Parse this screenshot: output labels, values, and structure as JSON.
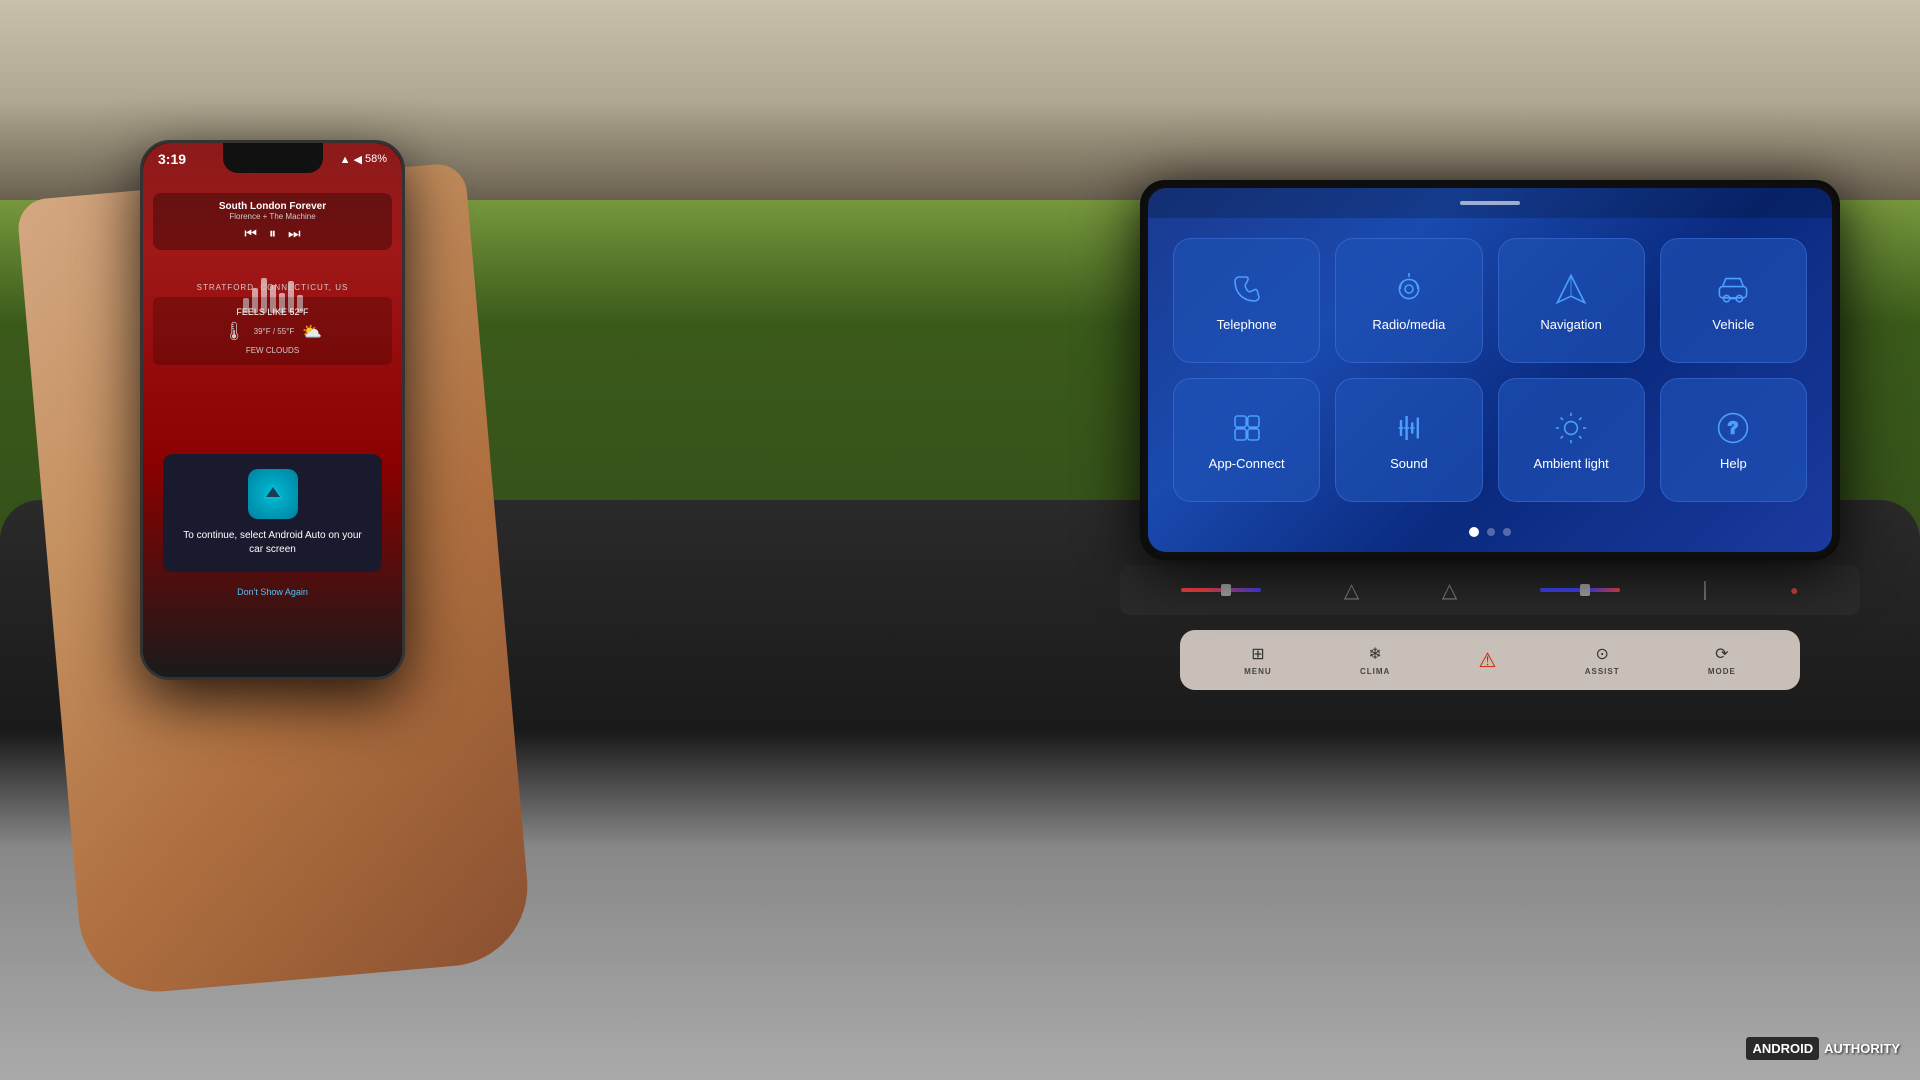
{
  "scene": {
    "bg_description": "Car interior with VW ID.4 infotainment screen"
  },
  "phone": {
    "status_bar": {
      "time": "3:19",
      "battery": "58%",
      "icons": "▲ ◀ ▶"
    },
    "music": {
      "title": "South London Forever",
      "subtitle": "Florence + The Machine"
    },
    "weather": {
      "location": "STRATFORD, CONNECTICUT, US",
      "feels_like": "FEELS LIKE 52°F",
      "temp": "39°F / 55°F",
      "condition": "FEW CLOUDS"
    },
    "android_auto": {
      "prompt": "To continue, select Android Auto on your car screen",
      "link": "Don't Show Again"
    }
  },
  "car_screen": {
    "menu_items": [
      {
        "id": "telephone",
        "label": "Telephone",
        "icon": "phone"
      },
      {
        "id": "radio_media",
        "label": "Radio/media",
        "icon": "music"
      },
      {
        "id": "navigation",
        "label": "Navigation",
        "icon": "navigation"
      },
      {
        "id": "vehicle",
        "label": "Vehicle",
        "icon": "car"
      },
      {
        "id": "app_connect",
        "label": "App-Connect",
        "icon": "app"
      },
      {
        "id": "sound",
        "label": "Sound",
        "icon": "sound"
      },
      {
        "id": "ambient_light",
        "label": "Ambient light",
        "icon": "light"
      },
      {
        "id": "help",
        "label": "Help",
        "icon": "help"
      }
    ],
    "page_dots": 3,
    "active_dot": 0
  },
  "car_buttons": [
    {
      "id": "menu",
      "label": "MENU",
      "icon": "⊞"
    },
    {
      "id": "clima",
      "label": "CLIMA",
      "icon": "❄"
    },
    {
      "id": "hazard",
      "label": "",
      "icon": "⚠"
    },
    {
      "id": "assist",
      "label": "ASSIST",
      "icon": "⊙"
    },
    {
      "id": "mode",
      "label": "MODE",
      "icon": "⟳"
    }
  ],
  "watermark": {
    "android": "ANDROID",
    "authority": "AUTHORITY"
  }
}
